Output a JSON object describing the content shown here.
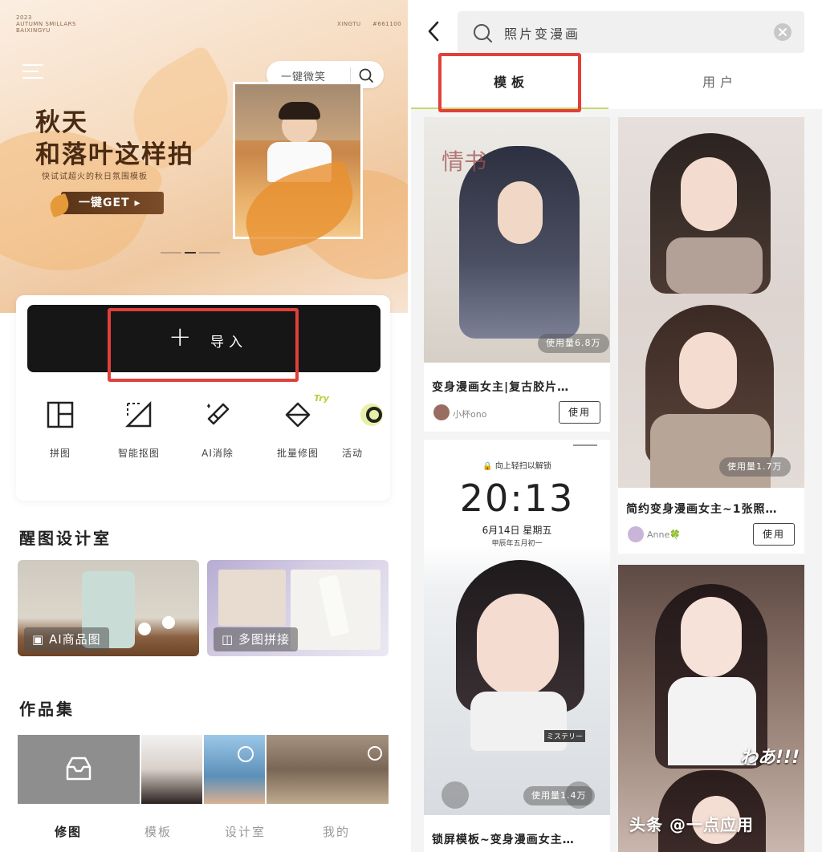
{
  "left": {
    "hero": {
      "top_note_left": "2023\nAUTUMN SMILLARS\nBAIXINGYU",
      "top_note_right": "XINGTU",
      "top_note_code": "#661100",
      "search_placeholder": "一键微笑",
      "title_line1": "秋天",
      "title_line2": "和落叶这样拍",
      "subtitle": "快试试超火的秋日氛围模板",
      "cta": "一键GET"
    },
    "import_label": "导入",
    "tools": [
      {
        "label": "拼图",
        "icon": "collage-icon"
      },
      {
        "label": "智能抠图",
        "icon": "cutout-icon"
      },
      {
        "label": "AI消除",
        "icon": "eraser-icon"
      },
      {
        "label": "批量修图",
        "icon": "batch-edit-icon"
      },
      {
        "label": "活动",
        "icon": "activity-icon"
      }
    ],
    "try_tag": "Try",
    "design_section_title": "醒图设计室",
    "design_cards": [
      {
        "label": "AI商品图"
      },
      {
        "label": "多图拼接"
      }
    ],
    "works_section_title": "作品集",
    "bottom_nav": [
      "修图",
      "模板",
      "设计室",
      "我的"
    ]
  },
  "right": {
    "search_text": "照片变漫画",
    "tabs": [
      "模板",
      "用户"
    ],
    "active_tab": 0,
    "cards": [
      {
        "title": "变身漫画女主|复古胶片…",
        "user": "小杯ono",
        "use_count": "使用量6.8万",
        "use_label": "使用",
        "image_text": "情书"
      },
      {
        "title": "简约变身漫画女主~1张照…",
        "user": "Anne🍀",
        "use_count": "使用量1.7万",
        "use_label": "使用"
      },
      {
        "title": "锁屏模板~变身漫画女主…",
        "use_count": "使用量1.4万",
        "lock_hint": "向上轻扫以解锁",
        "time": "20:13",
        "date": "6月14日 星期五",
        "lunar": "甲辰年五月初一",
        "sticker": "ミステリー"
      },
      {
        "overlay_text": "わあ!!!"
      }
    ]
  },
  "watermark": "头条 @一点应用",
  "colors": {
    "highlight": "#e0403a",
    "tab_underline": "#c7d96a",
    "import_bg": "#161616"
  }
}
